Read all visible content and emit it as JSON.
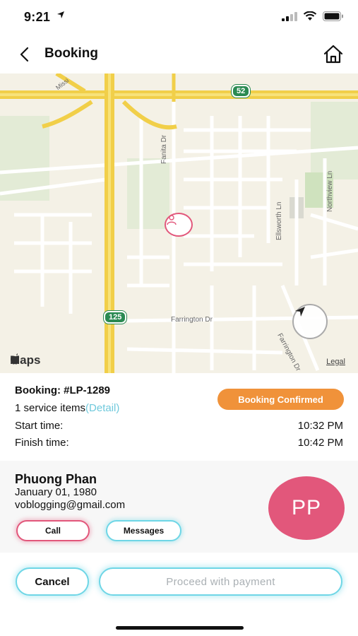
{
  "status_bar": {
    "time": "9:21"
  },
  "nav": {
    "title": "Booking"
  },
  "map": {
    "labels": {
      "road_top_left": "Missi",
      "highway_52": "52",
      "street_fanita": "Fanita Dr",
      "street_ellsworth": "Ellsworth Ln",
      "street_northview": "Northview Ln",
      "street_farrington": "Farrington Dr",
      "street_farrington_2": "Farrington Dr",
      "highway_125": "125"
    },
    "brand": "Maps",
    "legal": "Legal"
  },
  "booking": {
    "id_label": "Booking: #LP-1289",
    "items_text": "1 service items",
    "detail_link": "(Detail)",
    "status_badge": "Booking Confirmed",
    "start_label": "Start time:",
    "start_value": "10:32 PM",
    "finish_label": "Finish time:",
    "finish_value": "10:42 PM"
  },
  "customer": {
    "name": "Phuong Phan",
    "dob": "January 01, 1980",
    "email": "voblogging@gmail.com",
    "initials": "PP",
    "call_label": "Call",
    "messages_label": "Messages"
  },
  "actions": {
    "cancel_label": "Cancel",
    "proceed_label": "Proceed with payment"
  },
  "colors": {
    "accent_pink": "#e2577b",
    "accent_cyan": "#6fd6e6",
    "badge_orange": "#f0923a",
    "link_cyan": "#6fc9dc"
  }
}
